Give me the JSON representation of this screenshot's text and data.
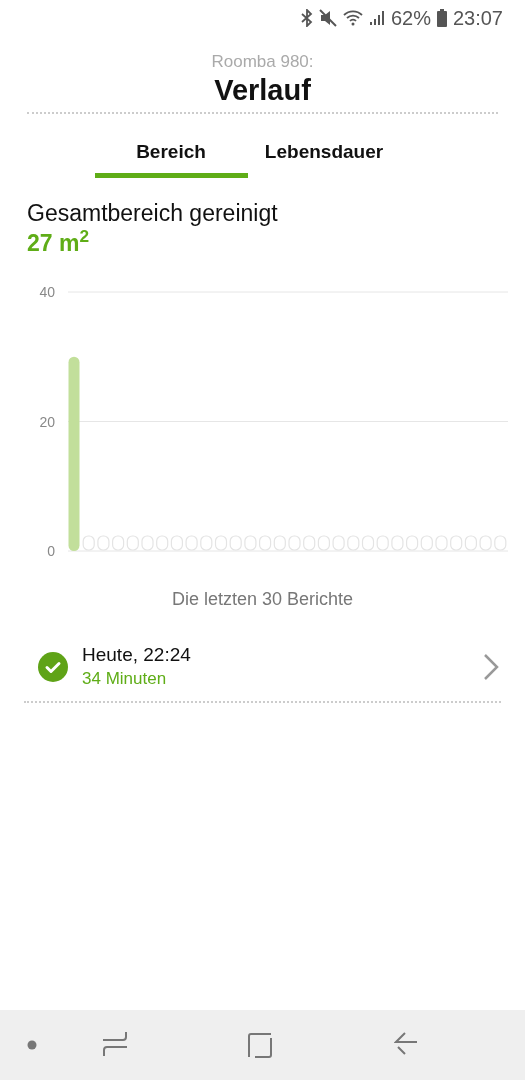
{
  "status_bar": {
    "battery": "62%",
    "time": "23:07"
  },
  "header": {
    "subtitle": "Roomba 980:",
    "title": "Verlauf"
  },
  "tabs": [
    {
      "label": "Bereich",
      "selected": true
    },
    {
      "label": "Lebensdauer",
      "selected": false
    }
  ],
  "summary": {
    "label": "Gesamtbereich gereinigt",
    "value": "27 m$^{2}$"
  },
  "chart_data": {
    "type": "bar",
    "ylim": [
      0,
      40
    ],
    "yticks": [
      0,
      20,
      40
    ],
    "series": [
      {
        "color": "#c2df9b",
        "values": [
          30,
          0,
          0,
          0,
          0,
          0,
          0,
          0,
          0,
          0,
          0,
          0,
          0,
          0,
          0,
          0,
          0,
          0,
          0,
          0,
          0,
          0,
          0,
          0,
          0,
          0,
          0,
          0,
          0,
          0
        ]
      }
    ]
  },
  "chart_caption": "Die letzten 30 Berichte",
  "reports": [
    {
      "title": "Heute, 22:24",
      "duration": "34 Minuten",
      "completed": true
    }
  ]
}
